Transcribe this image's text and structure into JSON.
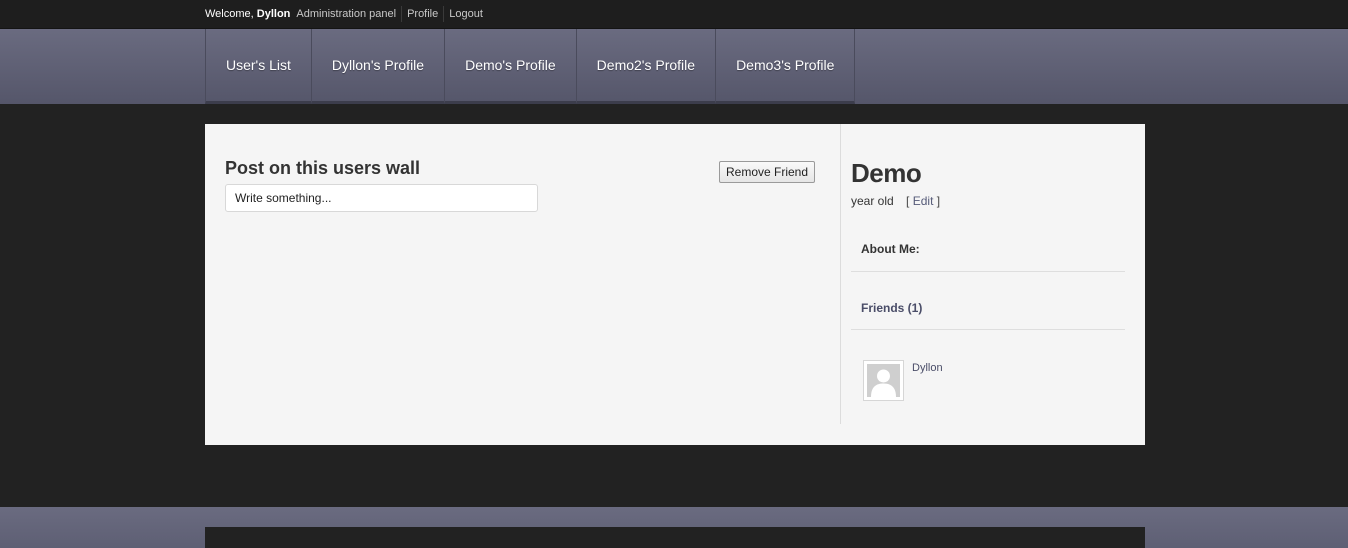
{
  "topbar": {
    "welcome_prefix": "Welcome,",
    "username": "Dyllon",
    "links": [
      "Administration panel",
      "Profile",
      "Logout"
    ]
  },
  "nav": {
    "tabs": [
      "User's List",
      "Dyllon's Profile",
      "Demo's Profile",
      "Demo2's Profile",
      "Demo3's Profile"
    ]
  },
  "wall": {
    "title": "Post on this users wall",
    "input_placeholder": "Write something...",
    "remove_friend_label": "Remove Friend"
  },
  "profile": {
    "name": "Demo",
    "age_text": "year old",
    "edit_open": "[",
    "edit_label": "Edit",
    "edit_close": "]",
    "about_label": "About Me:",
    "friends_label": "Friends (1)",
    "friends": [
      {
        "name": "Dyllon",
        "avatar_icon": "default-user-avatar-icon"
      }
    ]
  },
  "colors": {
    "nav_band": "#62637a",
    "page_bg": "#222222",
    "panel_bg": "#f5f5f5",
    "link": "#4a4d68"
  }
}
